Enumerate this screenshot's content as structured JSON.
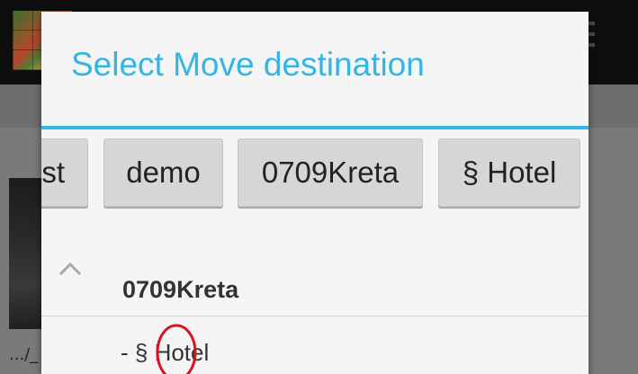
{
  "background": {
    "caption": ".../_",
    "thumbnail_icon": "photo-grid-thumbnail",
    "overflow_icon": "overflow-menu-icon"
  },
  "dialog": {
    "title": "Select Move destination",
    "accent_color": "#33b5e5",
    "breadcrumbs": [
      {
        "label": "st"
      },
      {
        "label": "demo"
      },
      {
        "label": "0709Kreta"
      },
      {
        "label": "§ Hotel"
      }
    ],
    "tree": {
      "collapse_icon": "chevron-up-icon",
      "root": "0709Kreta",
      "children": [
        {
          "label": "- § Hotel"
        }
      ]
    },
    "annotation": {
      "shape": "circle",
      "color": "#d9141b"
    }
  }
}
